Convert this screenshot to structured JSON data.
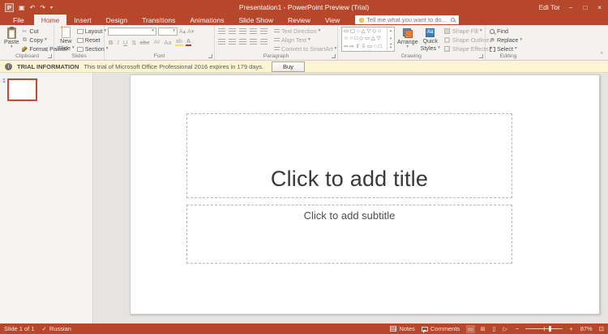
{
  "colors": {
    "accent": "#B7472A",
    "trial_bg": "#FBF5D3",
    "selected_thumb_border": "#C9492C"
  },
  "titlebar": {
    "app": "P",
    "title": "Presentation1 - PowerPoint Preview (Trial)",
    "user": "Edi Tor",
    "minimize": "−",
    "maximize": "□",
    "close": "×"
  },
  "icons": {
    "save": "▣",
    "undo": "↶",
    "redo": "↷",
    "caret": "▾",
    "caret_up": "▴",
    "cut": "✂",
    "copy": "⧉",
    "replace": "⇄",
    "spellcheck": "✓",
    "collapse": "^",
    "view_normal": "▭",
    "view_sorter": "⊞",
    "view_reading": "▯",
    "view_slideshow": "▷",
    "fit": "⊡"
  },
  "tabs": {
    "file": "File",
    "items": [
      "Home",
      "Insert",
      "Design",
      "Transitions",
      "Animations",
      "Slide Show",
      "Review",
      "View"
    ],
    "tell_me": "Tell me what you want to do..."
  },
  "ribbon": {
    "clipboard": {
      "label": "Clipboard",
      "paste": "Paste",
      "cut": "Cut",
      "copy": "Copy",
      "format_painter": "Format Painter"
    },
    "slides": {
      "label": "Slides",
      "new_line1": "New",
      "new_line2": "Slide",
      "layout": "Layout",
      "reset": "Reset",
      "section": "Section"
    },
    "font": {
      "label": "Font",
      "font_name": "",
      "font_size": "",
      "grow": "A▴",
      "shrink": "A▾",
      "bold": "B",
      "italic": "I",
      "underline": "U",
      "shadow": "S",
      "strike": "abc",
      "spacing": "AV",
      "case": "Aa",
      "highlight": "ab",
      "color": "A"
    },
    "paragraph": {
      "label": "Paragraph",
      "text_direction": "Text Direction",
      "align_text": "Align Text",
      "convert": "Convert to SmartArt"
    },
    "drawing": {
      "label": "Drawing",
      "shapes_rows": [
        "▭ ▢ ○ △ ▽ ◇ ⌂",
        "☆ ○ □ ◇ ▭ △ ▽",
        "⇦ ⇨ ⇧ ⇩ ▭ ○ □"
      ],
      "arrange": "Arrange",
      "quick1": "Quick",
      "quick2": "Styles",
      "shape_fill": "Shape Fill",
      "shape_outline": "Shape Outline",
      "shape_effects": "Shape Effects"
    },
    "editing": {
      "label": "Editing",
      "find": "Find",
      "replace": "Replace",
      "select": "Select"
    }
  },
  "trial": {
    "label": "TRIAL INFORMATION",
    "message": "This trial of Microsoft Office Professional 2016 expires in 179 days.",
    "buy": "Buy",
    "info": "i"
  },
  "slides_panel": {
    "number": "1"
  },
  "slide": {
    "title_placeholder": "Click to add title",
    "subtitle_placeholder": "Click to add subtitle"
  },
  "status": {
    "slide_info": "Slide 1 of 1",
    "language": "Russian",
    "notes": "Notes",
    "comments": "Comments",
    "zoom_out": "−",
    "zoom_in": "+",
    "zoom": "87%"
  }
}
